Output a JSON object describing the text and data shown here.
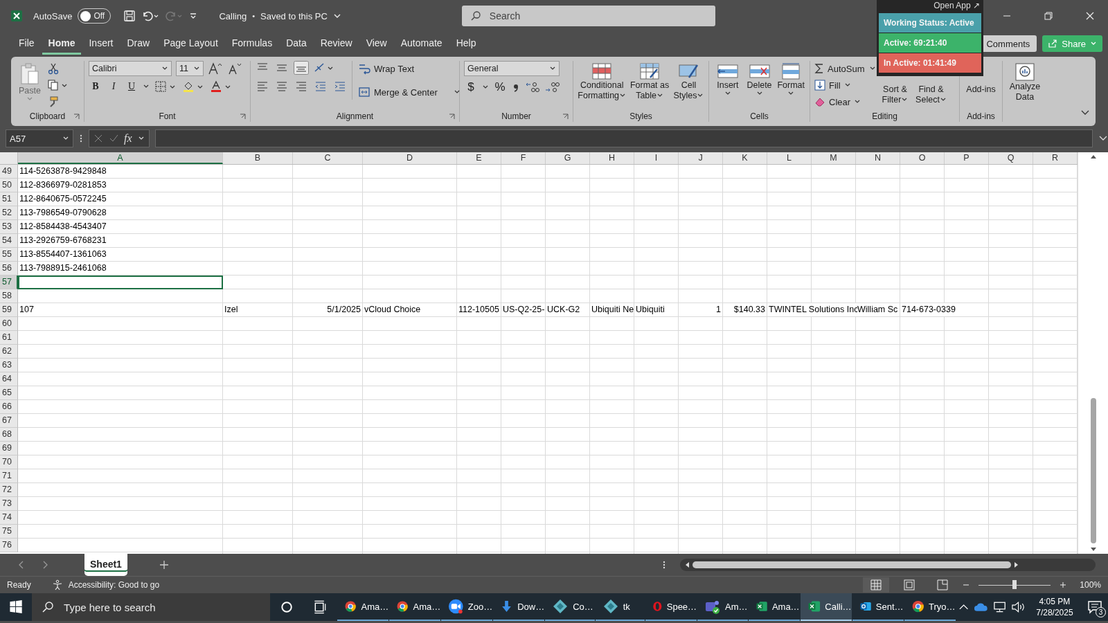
{
  "title_bar": {
    "autosave_label": "AutoSave",
    "autosave": {
      "on": false,
      "label": "Off"
    },
    "undo": {
      "disabled": false
    },
    "redo": {
      "disabled": true
    },
    "file_name": "Calling",
    "separator": "•",
    "save_status": "Saved to this PC",
    "search": {
      "placeholder": "Search"
    }
  },
  "tracker": {
    "open_app": "Open App ↗",
    "rows": [
      {
        "text": "Working Status: Active",
        "color": "#4aa0aa"
      },
      {
        "text": "Active: 69:21:40",
        "color": "#3cb36a"
      },
      {
        "text": "In Active: 01:41:49",
        "color": "#e0645a"
      }
    ]
  },
  "menu_tabs": [
    {
      "label": "File",
      "selected": false
    },
    {
      "label": "Home",
      "selected": true
    },
    {
      "label": "Insert",
      "selected": false
    },
    {
      "label": "Draw",
      "selected": false
    },
    {
      "label": "Page Layout",
      "selected": false
    },
    {
      "label": "Formulas",
      "selected": false
    },
    {
      "label": "Data",
      "selected": false
    },
    {
      "label": "Review",
      "selected": false
    },
    {
      "label": "View",
      "selected": false
    },
    {
      "label": "Automate",
      "selected": false
    },
    {
      "label": "Help",
      "selected": false
    }
  ],
  "comments_button": "Comments",
  "share_button": "Share",
  "ribbon": {
    "clipboard": {
      "label": "Clipboard",
      "paste": "Paste"
    },
    "font": {
      "label": "Font",
      "family": "Calibri",
      "size": "11",
      "bold": "B",
      "italic": "I",
      "underline": "U"
    },
    "alignment": {
      "label": "Alignment",
      "wrap_text": "Wrap Text",
      "merge_center": "Merge & Center"
    },
    "number": {
      "label": "Number",
      "format": "General",
      "currency": "$",
      "percent": "%"
    },
    "styles": {
      "label": "Styles",
      "buttons": [
        "Conditional Formatting",
        "Format as Table",
        "Cell Styles"
      ]
    },
    "cells": {
      "label": "Cells",
      "buttons": [
        "Insert",
        "Delete",
        "Format"
      ]
    },
    "editing": {
      "label": "Editing",
      "autosum": "AutoSum",
      "fill": "Fill",
      "clear": "Clear",
      "buttons": [
        "Sort & Filter",
        "Find & Select"
      ]
    },
    "addins": {
      "label": "Add-ins",
      "button": "Add-ins"
    },
    "analyze": {
      "button": "Analyze Data"
    }
  },
  "formula_bar": {
    "name_box": "A57",
    "fx": "fx"
  },
  "columns": [
    {
      "label": "A",
      "selected": true
    },
    {
      "label": "B",
      "selected": false
    },
    {
      "label": "C",
      "selected": false
    },
    {
      "label": "D",
      "selected": false
    },
    {
      "label": "E",
      "selected": false
    },
    {
      "label": "F",
      "selected": false
    },
    {
      "label": "G",
      "selected": false
    },
    {
      "label": "H",
      "selected": false
    },
    {
      "label": "I",
      "selected": false
    },
    {
      "label": "J",
      "selected": false
    },
    {
      "label": "K",
      "selected": false
    },
    {
      "label": "L",
      "selected": false
    },
    {
      "label": "M",
      "selected": false
    },
    {
      "label": "N",
      "selected": false
    },
    {
      "label": "O",
      "selected": false
    },
    {
      "label": "P",
      "selected": false
    },
    {
      "label": "Q",
      "selected": false
    },
    {
      "label": "R",
      "selected": false
    }
  ],
  "rows": [
    {
      "number": "49",
      "selected": false,
      "cells": [
        {
          "text": "114-5263878-9429848",
          "kind": "text"
        }
      ]
    },
    {
      "number": "50",
      "selected": false,
      "cells": [
        {
          "text": "112-8366979-0281853",
          "kind": "text"
        }
      ]
    },
    {
      "number": "51",
      "selected": false,
      "cells": [
        {
          "text": "112-8640675-0572245",
          "kind": "text"
        }
      ]
    },
    {
      "number": "52",
      "selected": false,
      "cells": [
        {
          "text": "113-7986549-0790628",
          "kind": "text"
        }
      ]
    },
    {
      "number": "53",
      "selected": false,
      "cells": [
        {
          "text": "112-8584438-4543407",
          "kind": "text"
        }
      ]
    },
    {
      "number": "54",
      "selected": false,
      "cells": [
        {
          "text": "113-2926759-6768231",
          "kind": "text"
        }
      ]
    },
    {
      "number": "55",
      "selected": false,
      "cells": [
        {
          "text": "113-8554407-1361063",
          "kind": "text"
        }
      ]
    },
    {
      "number": "56",
      "selected": false,
      "cells": [
        {
          "text": "113-7988915-2461068",
          "kind": "text"
        }
      ]
    },
    {
      "number": "57",
      "selected": true
    },
    {
      "number": "58",
      "selected": false
    },
    {
      "number": "59",
      "selected": false,
      "cells": [
        {
          "text": "107",
          "kind": "text"
        },
        {
          "text": "Izel",
          "kind": "text"
        },
        {
          "text": "5/1/2025",
          "kind": "number"
        },
        {
          "text": "vCloud Choice",
          "kind": "text"
        },
        {
          "text": "112-10505",
          "kind": "text"
        },
        {
          "text": "US-Q2-25-",
          "kind": "text"
        },
        {
          "text": "UCK-G2",
          "kind": "text"
        },
        {
          "text": "Ubiquiti Ne",
          "kind": "text"
        },
        {
          "text": "Ubiquiti",
          "kind": "text"
        },
        {
          "text": "1",
          "kind": "number"
        },
        {
          "text": "$140.33",
          "kind": "number"
        },
        {
          "text": "TWINTEL Solutions Inc",
          "kind": "text"
        },
        {
          "kind": "empty"
        },
        {
          "text": "William Sc",
          "kind": "text"
        },
        {
          "text": "714-673-0339",
          "kind": "text"
        }
      ]
    },
    {
      "number": "60",
      "selected": false
    },
    {
      "number": "61",
      "selected": false
    },
    {
      "number": "62",
      "selected": false
    },
    {
      "number": "63",
      "selected": false
    },
    {
      "number": "64",
      "selected": false
    },
    {
      "number": "65",
      "selected": false
    },
    {
      "number": "66",
      "selected": false
    },
    {
      "number": "67",
      "selected": false
    },
    {
      "number": "68",
      "selected": false
    },
    {
      "number": "69",
      "selected": false
    },
    {
      "number": "70",
      "selected": false
    },
    {
      "number": "71",
      "selected": false
    },
    {
      "number": "72",
      "selected": false
    },
    {
      "number": "73",
      "selected": false
    },
    {
      "number": "74",
      "selected": false
    },
    {
      "number": "75",
      "selected": false
    },
    {
      "number": "76",
      "selected": false
    }
  ],
  "sheet_tabs": [
    {
      "label": "Sheet1",
      "selected": true
    }
  ],
  "status_bar": {
    "mode": "Ready",
    "accessibility": "Accessibility: Good to go",
    "zoom": {
      "level": 0.5,
      "reading": "100%"
    }
  },
  "taskbar": {
    "search": {
      "placeholder": "Type here to search"
    },
    "apps": [
      {
        "label": "Ama…",
        "kind": "browser",
        "selected": false
      },
      {
        "label": "Ama…",
        "kind": "browser",
        "selected": false
      },
      {
        "label": "Zoo…",
        "kind": "meeting",
        "selected": false
      },
      {
        "label": "Dow…",
        "kind": "download",
        "selected": false
      },
      {
        "label": "Co…",
        "kind": "diamond",
        "selected": false
      },
      {
        "label": "tk",
        "kind": "diamond",
        "selected": false
      },
      {
        "label": "Spee…",
        "kind": "ring",
        "selected": false
      },
      {
        "label": "Am…",
        "kind": "chat",
        "selected": false
      },
      {
        "label": "Ama…",
        "kind": "sheet",
        "selected": false
      },
      {
        "label": "Calli…",
        "kind": "sheet",
        "selected": true
      },
      {
        "label": "Sent…",
        "kind": "mail",
        "selected": false
      },
      {
        "label": "Tryo…",
        "kind": "browser",
        "selected": false
      }
    ],
    "time": "4:05 PM",
    "date": "7/28/2025",
    "notifications": "3"
  }
}
